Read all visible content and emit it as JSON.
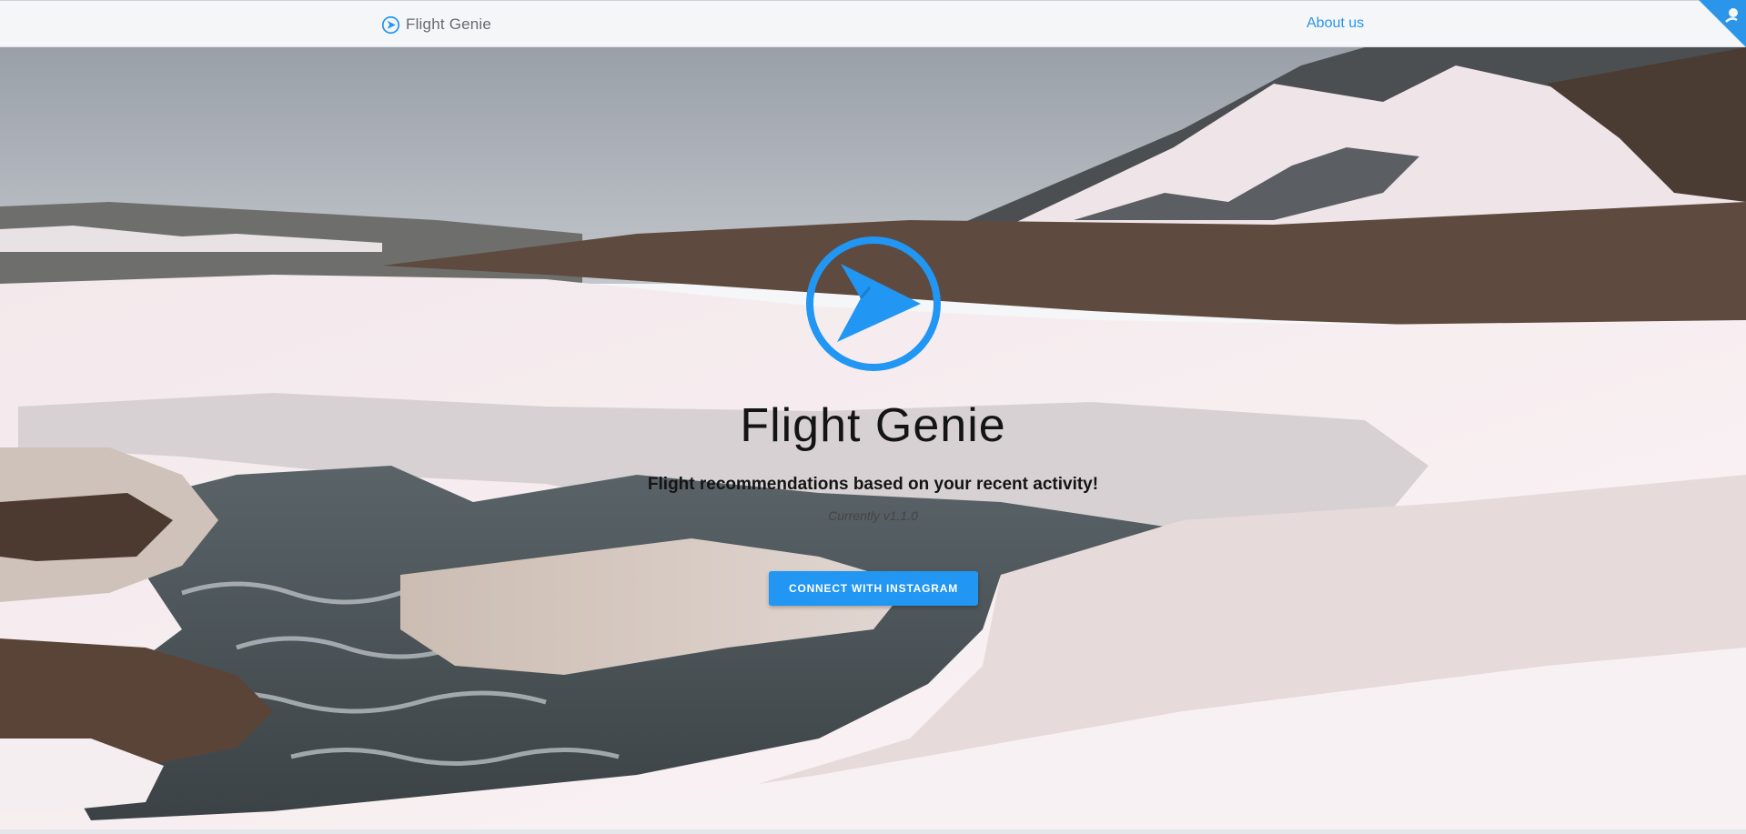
{
  "nav": {
    "brand_icon": "paper-plane-circle-icon",
    "brand_name": "Flight Genie",
    "about_label": "About us",
    "corner_icon": "github-octocat-corner-icon"
  },
  "hero": {
    "background_image": "snowy-mountain-river-landscape",
    "logo_icon": "paper-plane-circle-icon",
    "title": "Flight Genie",
    "subtitle": "Flight recommendations based on your recent activity!",
    "version_text": "Currently v1.1.0",
    "connect_button_label": "CONNECT WITH INSTAGRAM"
  },
  "colors": {
    "accent": "#2196f3",
    "link": "#2a95e9",
    "navbar_bg": "#f5f6f8",
    "title_text": "#141414"
  }
}
